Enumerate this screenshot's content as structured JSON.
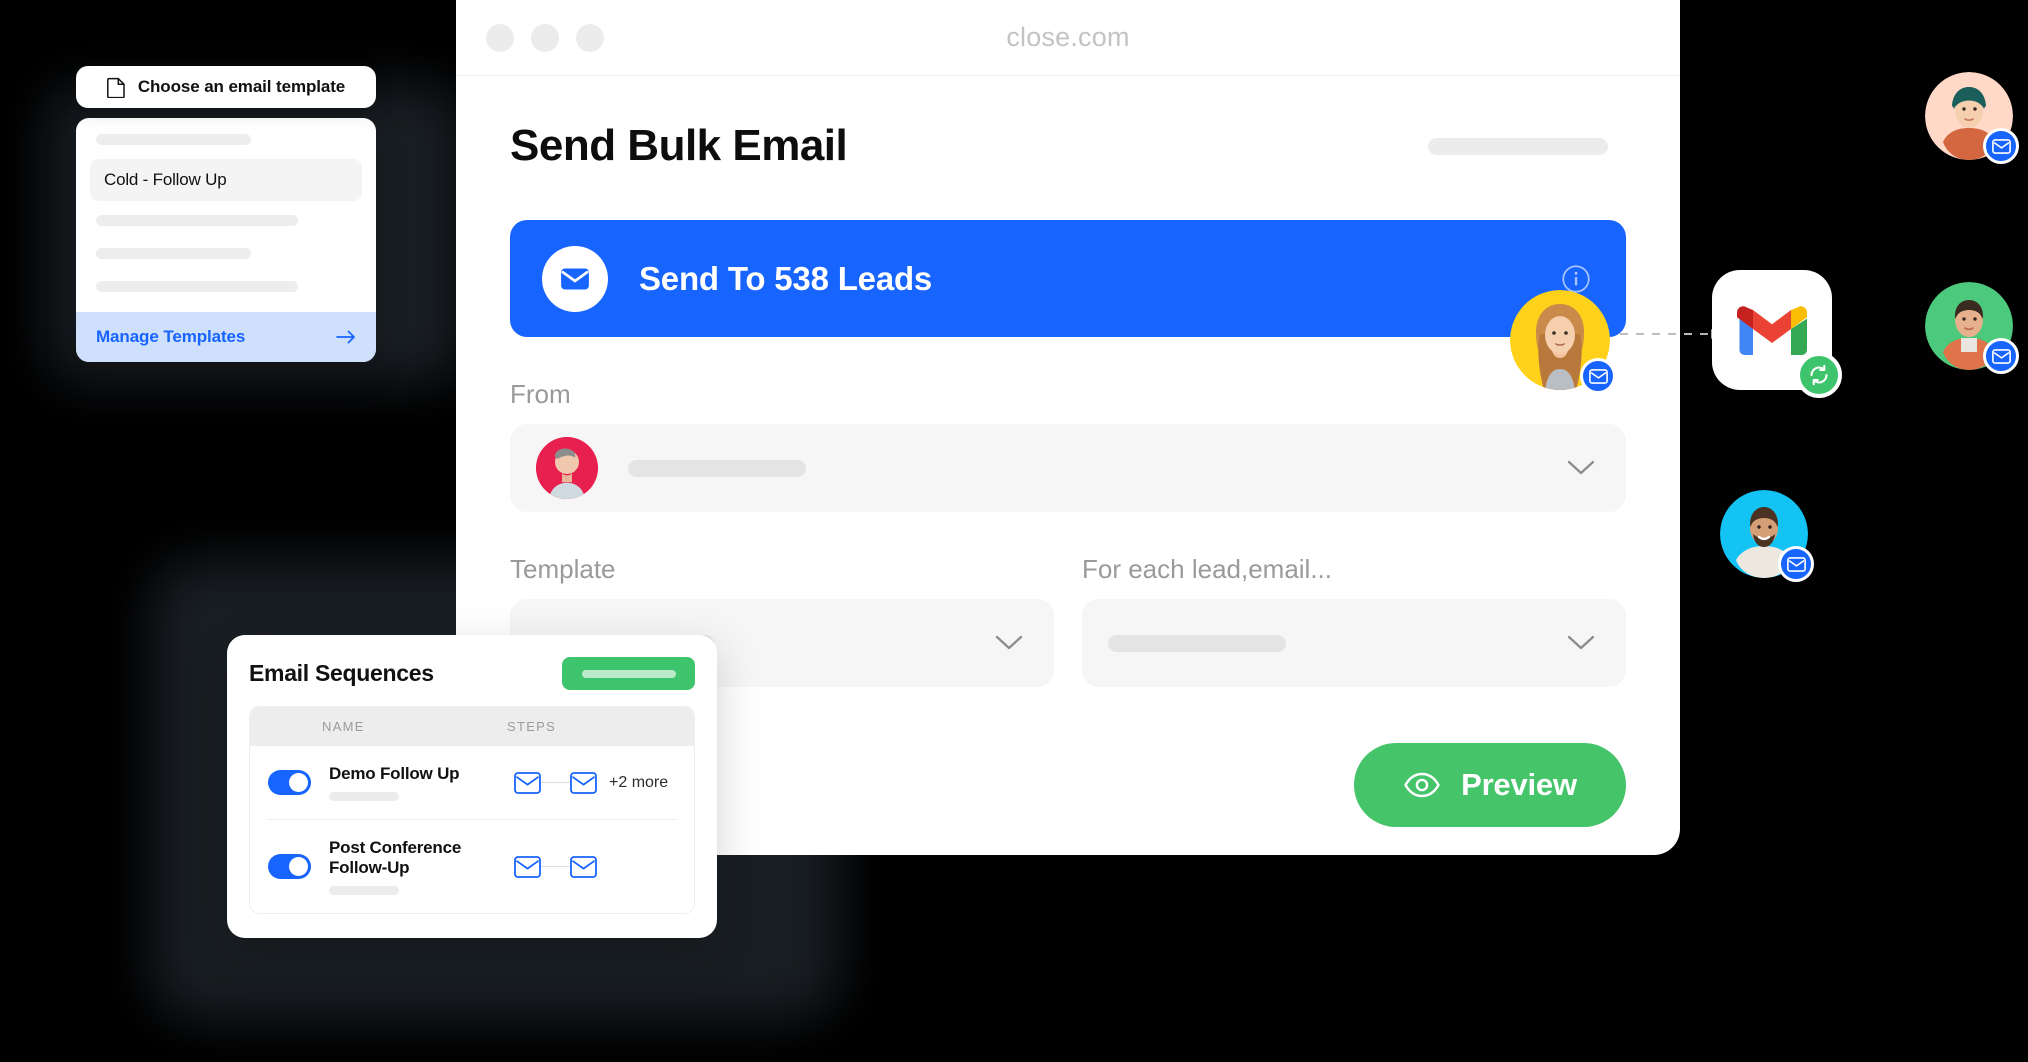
{
  "colors": {
    "accent_blue": "#1764ff",
    "accent_green": "#45c46a",
    "sequence_green": "#3ec46c",
    "manage_bg": "#cfe0fd",
    "page_bg": "#000000",
    "card_bg": "#ffffff",
    "field_bg": "#f6f6f6"
  },
  "browser": {
    "url": "close.com",
    "traffic_lights": [
      "window-close",
      "window-minimize",
      "window-zoom"
    ]
  },
  "page": {
    "title": "Send Bulk Email",
    "bulk_banner": {
      "label": "Send To 538 Leads",
      "lead_count": "538",
      "icon": "envelope-icon",
      "info_icon": "info-icon"
    },
    "fields": [
      {
        "label": "From",
        "value": "",
        "icon": "avatar",
        "chevron": "chevron-down-icon"
      },
      {
        "label": "Template",
        "value": "",
        "chevron": "chevron-down-icon"
      },
      {
        "label": "For each lead,email...",
        "value": "",
        "chevron": "chevron-down-icon"
      }
    ],
    "preview_button": {
      "label": "Preview",
      "icon": "eye-icon"
    }
  },
  "template_popover": {
    "pill_label": "Choose an email template",
    "pill_icon": "document-icon",
    "selected_item": "Cold - Follow Up",
    "footer_label": "Manage Templates",
    "footer_icon": "arrow-right-icon"
  },
  "email_sequences": {
    "title": "Email Sequences",
    "add_button_label": "",
    "columns": [
      "NAME",
      "STEPS"
    ],
    "rows": [
      {
        "enabled": true,
        "name": "Demo Follow Up",
        "steps_icons": [
          "envelope-icon",
          "envelope-icon"
        ],
        "steps_more": "+2 more"
      },
      {
        "enabled": true,
        "name": "Post Conference Follow-Up",
        "steps_icons": [
          "envelope-icon",
          "envelope-icon"
        ],
        "steps_more": ""
      }
    ]
  },
  "integrations": {
    "gmail": {
      "icon": "gmail-icon",
      "status_icon": "sync-icon"
    },
    "avatars": [
      {
        "name": "avatar-banner-woman",
        "badge": "envelope-icon",
        "bg": "#ffd11a"
      },
      {
        "name": "avatar-top-right-woman",
        "badge": "envelope-icon",
        "bg": "#ffd8c7"
      },
      {
        "name": "avatar-mid-right-man",
        "badge": "envelope-icon",
        "bg": "#4dc97d"
      },
      {
        "name": "avatar-lower-man",
        "badge": "envelope-icon",
        "bg": "#12c3f3"
      }
    ]
  }
}
